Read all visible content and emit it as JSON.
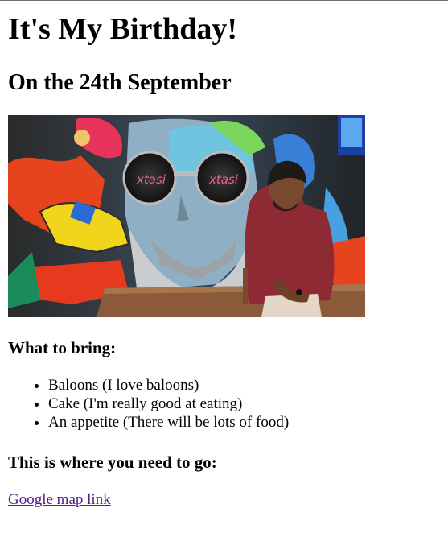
{
  "page": {
    "title": "It's My Birthday!",
    "subtitle": "On the 24th September",
    "bring_heading": "What to bring:",
    "bring_items": [
      "Baloons (I love baloons)",
      "Cake (I'm really good at eating)",
      "An appetite (There will be lots of food)"
    ],
    "go_heading": "This is where you need to go:",
    "map_link_label": "Google map link"
  },
  "photo": {
    "description_icon": "photo-of-person-in-front-of-mural",
    "sunglasses_text": "Xtasi"
  },
  "colors": {
    "link_visited": "#551a8b",
    "text": "#000000",
    "background": "#ffffff"
  }
}
